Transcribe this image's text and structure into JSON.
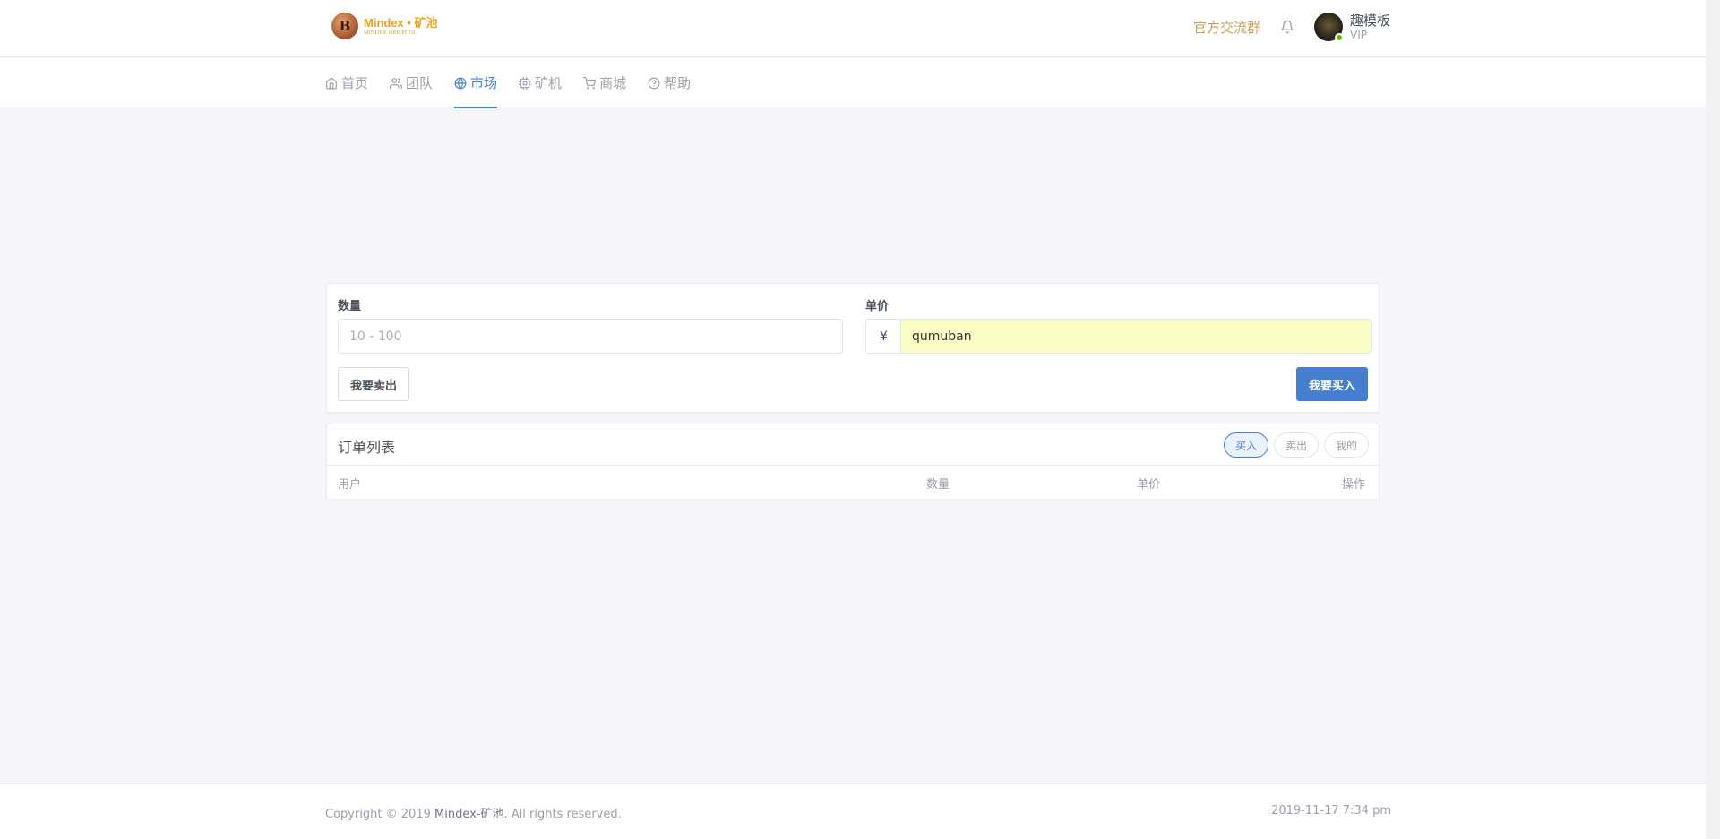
{
  "header": {
    "brand_title": "Mindex • 矿池",
    "brand_sub": "MINDEX ORE POOL",
    "brand_coin_letter": "B",
    "group_link": "官方交流群",
    "user_name": "趣模板",
    "user_level": "VIP"
  },
  "nav": {
    "items": [
      {
        "label": "首页",
        "icon": "home-icon"
      },
      {
        "label": "团队",
        "icon": "users-icon"
      },
      {
        "label": "市场",
        "icon": "globe-icon"
      },
      {
        "label": "矿机",
        "icon": "cpu-icon"
      },
      {
        "label": "商城",
        "icon": "cart-icon"
      },
      {
        "label": "帮助",
        "icon": "help-circle-icon"
      }
    ],
    "active": "市场"
  },
  "trade": {
    "qty_label": "数量",
    "qty_placeholder": "10 - 100",
    "price_label": "单价",
    "currency_symbol": "¥",
    "price_value": "qumuban",
    "sell_button": "我要卖出",
    "buy_button": "我要买入"
  },
  "orders": {
    "title": "订单列表",
    "filters": [
      "买入",
      "卖出",
      "我的"
    ],
    "active_filter": "买入",
    "columns": {
      "user": "用户",
      "qty": "数量",
      "price": "单价",
      "op": "操作"
    }
  },
  "footer": {
    "copyright_prefix": "Copyright © 2019 ",
    "copyright_brand": "Mindex-矿池",
    "copyright_suffix": ". All rights reserved.",
    "timestamp": "2019-11-17 7:34 pm"
  },
  "colors": {
    "primary": "#467fcf",
    "brand_gold": "#f0a020",
    "group_link": "#c9a15e",
    "online": "#5eba00",
    "autofill_bg": "#fafdc4"
  }
}
